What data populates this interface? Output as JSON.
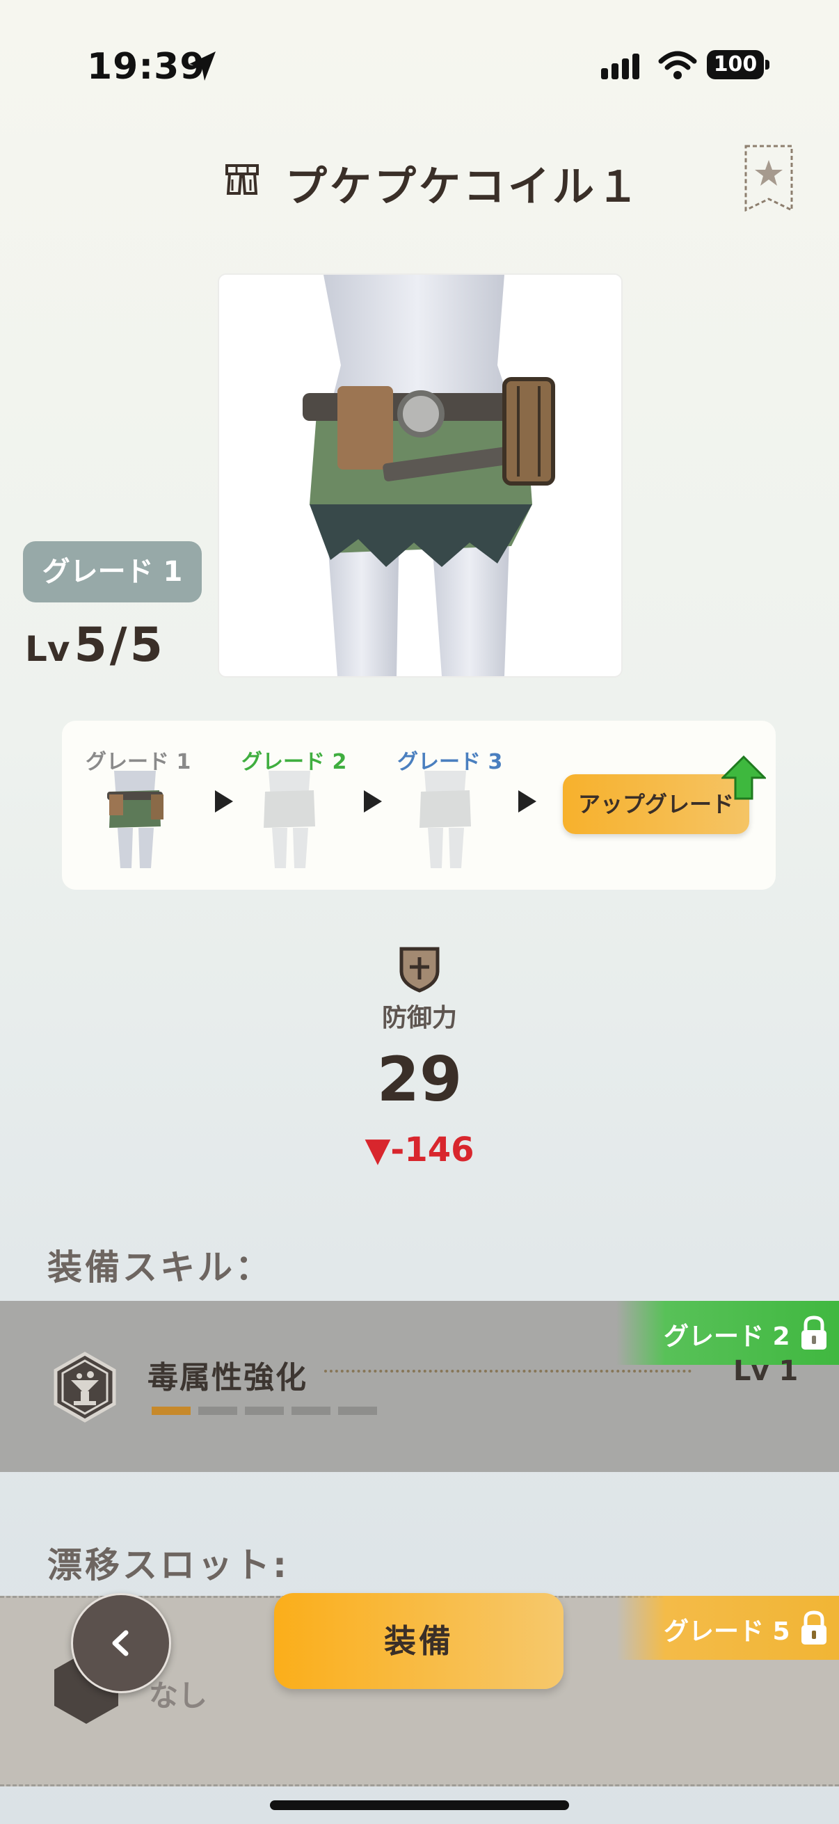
{
  "status_bar": {
    "time": "19:39",
    "battery": "100",
    "icons": [
      "location-arrow-icon",
      "cellular-signal-icon",
      "wifi-icon",
      "battery-icon"
    ]
  },
  "header": {
    "title": "プケプケコイル１",
    "armor_icon": "waist-armor-icon",
    "favorite_icon": "star-bookmark-icon"
  },
  "equipment": {
    "grade_badge": "グレード 1",
    "level_prefix": "Lv",
    "level_value": "5/5"
  },
  "upgrade": {
    "grades": [
      {
        "label": "グレード 1",
        "color": "#8a8a8a",
        "active": true
      },
      {
        "label": "グレード 2",
        "color": "#3fae3f",
        "active": false
      },
      {
        "label": "グレード 3",
        "color": "#4a7fbf",
        "active": false
      }
    ],
    "button_label": "アップグレード"
  },
  "stats": {
    "defense_label": "防御力",
    "defense_value": "29",
    "defense_diff": "▼-146",
    "diff_color": "#d8262d"
  },
  "skills": {
    "heading": "装備スキル：",
    "items": [
      {
        "name": "毒属性強化",
        "level": "Lv 1",
        "max_level": 5,
        "current": 1,
        "lock_label": "グレード 2"
      }
    ]
  },
  "drift_slot": {
    "heading": "漂移スロット:",
    "value": "なし",
    "lock_label": "グレード 5"
  },
  "actions": {
    "equip_label": "装備",
    "back_icon": "chevron-left-icon"
  },
  "colors": {
    "accent_orange": "#f7b12c",
    "grade_green": "#40b840"
  }
}
